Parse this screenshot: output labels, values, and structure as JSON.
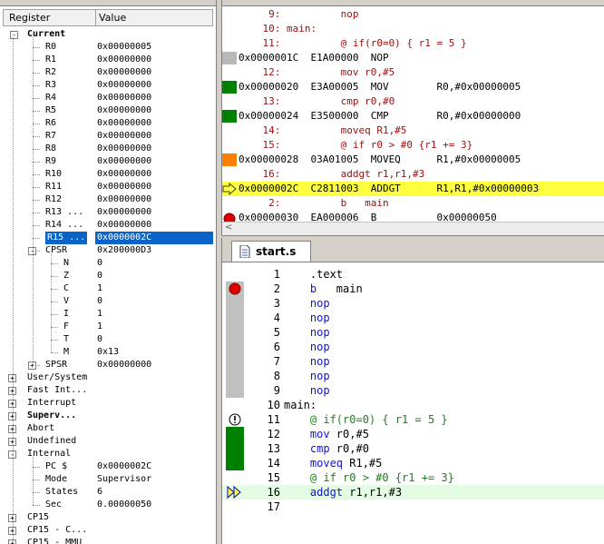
{
  "registers": {
    "header": {
      "col_register": "Register",
      "col_value": "Value"
    },
    "current_label": "Current",
    "rows": [
      {
        "name": "R0",
        "value": "0x00000005"
      },
      {
        "name": "R1",
        "value": "0x00000000"
      },
      {
        "name": "R2",
        "value": "0x00000000"
      },
      {
        "name": "R3",
        "value": "0x00000000"
      },
      {
        "name": "R4",
        "value": "0x00000000"
      },
      {
        "name": "R5",
        "value": "0x00000000"
      },
      {
        "name": "R6",
        "value": "0x00000000"
      },
      {
        "name": "R7",
        "value": "0x00000000"
      },
      {
        "name": "R8",
        "value": "0x00000000"
      },
      {
        "name": "R9",
        "value": "0x00000000"
      },
      {
        "name": "R10",
        "value": "0x00000000"
      },
      {
        "name": "R11",
        "value": "0x00000000"
      },
      {
        "name": "R12",
        "value": "0x00000000"
      },
      {
        "name": "R13 ...",
        "value": "0x00000000"
      },
      {
        "name": "R14 ...",
        "value": "0x00000000"
      },
      {
        "name": "R15 ...",
        "value": "0x0000002C"
      }
    ],
    "cpsr": {
      "name": "CPSR",
      "value": "0x200000D3"
    },
    "flags": [
      {
        "name": "N",
        "value": "0"
      },
      {
        "name": "Z",
        "value": "0"
      },
      {
        "name": "C",
        "value": "1"
      },
      {
        "name": "V",
        "value": "0"
      },
      {
        "name": "I",
        "value": "1"
      },
      {
        "name": "F",
        "value": "1"
      },
      {
        "name": "T",
        "value": "0"
      },
      {
        "name": "M",
        "value": "0x13"
      }
    ],
    "spsr": {
      "name": "SPSR",
      "value": "0x00000000"
    },
    "groups": [
      "User/System",
      "Fast Int...",
      "Interrupt",
      "Superv...",
      "Abort",
      "Undefined"
    ],
    "internal_label": "Internal",
    "internal": [
      {
        "name": "PC  $",
        "value": "0x0000002C"
      },
      {
        "name": "Mode",
        "value": "Supervisor"
      },
      {
        "name": "States",
        "value": "6"
      },
      {
        "name": "Sec",
        "value": "0.00000050"
      }
    ],
    "tail_groups": [
      "CP15",
      "CP15 - C...",
      "CP15 - MMU"
    ]
  },
  "disassembly": {
    "lines": [
      {
        "kind": "src",
        "text": "     9:          nop"
      },
      {
        "kind": "src",
        "text": "    10: main:"
      },
      {
        "kind": "src",
        "text": "    11:          @ if(r0=0) { r1 = 5 }"
      },
      {
        "kind": "asm",
        "text": "0x0000001C  E1A00000  NOP"
      },
      {
        "kind": "src",
        "text": "    12:          mov r0,#5"
      },
      {
        "kind": "asm",
        "text": "0x00000020  E3A00005  MOV        R0,#0x00000005"
      },
      {
        "kind": "src",
        "text": "    13:          cmp r0,#0"
      },
      {
        "kind": "asm",
        "text": "0x00000024  E3500000  CMP        R0,#0x00000000"
      },
      {
        "kind": "src",
        "text": "    14:          moveq R1,#5"
      },
      {
        "kind": "src",
        "text": "    15:          @ if r0 > #0 {r1 += 3}"
      },
      {
        "kind": "asm",
        "text": "0x00000028  03A01005  MOVEQ      R1,#0x00000005"
      },
      {
        "kind": "src",
        "text": "    16:          addgt r1,r1,#3"
      },
      {
        "kind": "asm",
        "text": "0x0000002C  C2811003  ADDGT      R1,R1,#0x00000003"
      },
      {
        "kind": "src",
        "text": "     2:          b   main"
      },
      {
        "kind": "asm",
        "text": "0x00000030  EA000006  B          0x00000050"
      }
    ]
  },
  "editor": {
    "tab_label": "start.s",
    "lines": [
      {
        "n": "1",
        "parts": [
          {
            "c": "plain",
            "t": "    .text"
          }
        ]
      },
      {
        "n": "2",
        "parts": [
          {
            "c": "kw",
            "t": "    b"
          },
          {
            "c": "plain",
            "t": "   main"
          }
        ]
      },
      {
        "n": "3",
        "parts": [
          {
            "c": "kw",
            "t": "    nop"
          }
        ]
      },
      {
        "n": "4",
        "parts": [
          {
            "c": "kw",
            "t": "    nop"
          }
        ]
      },
      {
        "n": "5",
        "parts": [
          {
            "c": "kw",
            "t": "    nop"
          }
        ]
      },
      {
        "n": "6",
        "parts": [
          {
            "c": "kw",
            "t": "    nop"
          }
        ]
      },
      {
        "n": "7",
        "parts": [
          {
            "c": "kw",
            "t": "    nop"
          }
        ]
      },
      {
        "n": "8",
        "parts": [
          {
            "c": "kw",
            "t": "    nop"
          }
        ]
      },
      {
        "n": "9",
        "parts": [
          {
            "c": "kw",
            "t": "    nop"
          }
        ]
      },
      {
        "n": "10",
        "parts": [
          {
            "c": "plain",
            "t": "main:"
          }
        ]
      },
      {
        "n": "11",
        "parts": [
          {
            "c": "cm",
            "t": "    @ if(r0=0) { r1 = 5 }"
          }
        ]
      },
      {
        "n": "12",
        "parts": [
          {
            "c": "kw",
            "t": "    mov"
          },
          {
            "c": "plain",
            "t": " r0,#5"
          }
        ]
      },
      {
        "n": "13",
        "parts": [
          {
            "c": "kw",
            "t": "    cmp"
          },
          {
            "c": "plain",
            "t": " r0,#0"
          }
        ]
      },
      {
        "n": "14",
        "parts": [
          {
            "c": "kw",
            "t": "    moveq"
          },
          {
            "c": "plain",
            "t": " R1,#5"
          }
        ]
      },
      {
        "n": "15",
        "parts": [
          {
            "c": "cm",
            "t": "    @ if r0 > #0 {r1 += 3}"
          }
        ]
      },
      {
        "n": "16",
        "parts": [
          {
            "c": "kw",
            "t": "    addgt"
          },
          {
            "c": "plain",
            "t": " r1,r1,#3"
          }
        ]
      },
      {
        "n": "17",
        "parts": [
          {
            "c": "plain",
            "t": ""
          }
        ]
      }
    ]
  },
  "colors": {
    "selection": "#0a64c8",
    "current_instruction": "#ffff40",
    "executed_marker": "#008000",
    "partial_marker": "#ff8000",
    "breakpoint": "#e00000",
    "keyword": "#1010e0",
    "comment": "#208020",
    "source_line": "#a01010"
  }
}
